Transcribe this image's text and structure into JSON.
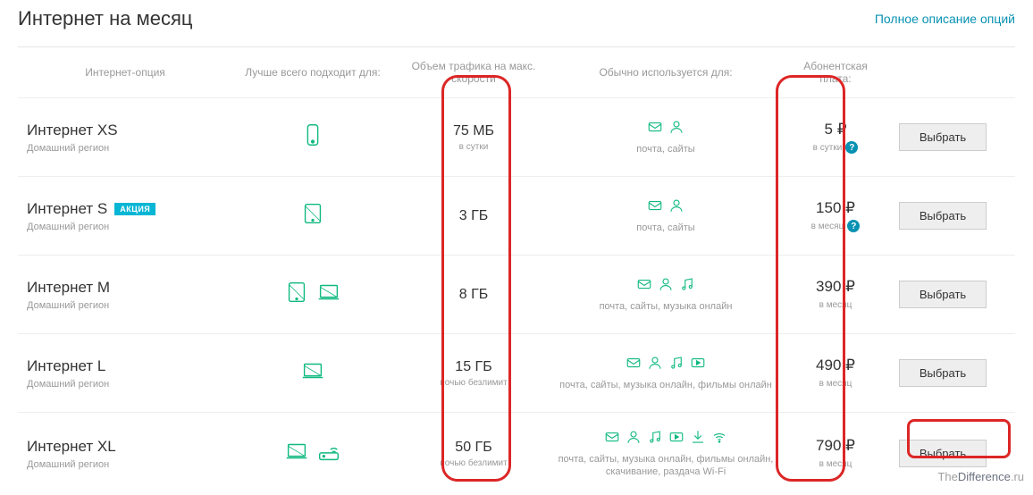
{
  "header": {
    "title": "Интернет на месяц",
    "link": "Полное описание опций"
  },
  "columns": {
    "c1": "Интернет-опция",
    "c2": "Лучше всего подходит для:",
    "c3": "Объем трафика на макс. скорости",
    "c4": "Обычно используется для:",
    "c5": "Абонентская плата:"
  },
  "plans": [
    {
      "name": "Интернет XS",
      "sub": "Домашний регион",
      "badge": "",
      "volume": "75 МБ",
      "volsub": "в сутки",
      "usage": "почта, сайты",
      "price": "5",
      "pricesub": "в сутки",
      "info": true
    },
    {
      "name": "Интернет S",
      "sub": "Домашний регион",
      "badge": "АКЦИЯ",
      "volume": "3 ГБ",
      "volsub": "",
      "usage": "почта, сайты",
      "price": "150",
      "pricesub": "в месяц",
      "info": true
    },
    {
      "name": "Интернет M",
      "sub": "Домашний регион",
      "badge": "",
      "volume": "8 ГБ",
      "volsub": "",
      "usage": "почта, сайты, музыка онлайн",
      "price": "390",
      "pricesub": "в месяц",
      "info": false
    },
    {
      "name": "Интернет L",
      "sub": "Домашний регион",
      "badge": "",
      "volume": "15 ГБ",
      "volsub": "ночью безлимит",
      "usage": "почта, сайты, музыка онлайн, фильмы онлайн",
      "price": "490",
      "pricesub": "в месяц",
      "info": false
    },
    {
      "name": "Интернет XL",
      "sub": "Домашний регион",
      "badge": "",
      "volume": "50 ГБ",
      "volsub": "ночью безлимит",
      "usage": "почта, сайты, музыка онлайн, фильмы онлайн, скачивание, раздача Wi-Fi",
      "price": "790",
      "pricesub": "в месяц",
      "info": false
    }
  ],
  "button_label": "Выбрать",
  "watermark": {
    "a": "The",
    "b": "Difference",
    "c": ".ru"
  }
}
